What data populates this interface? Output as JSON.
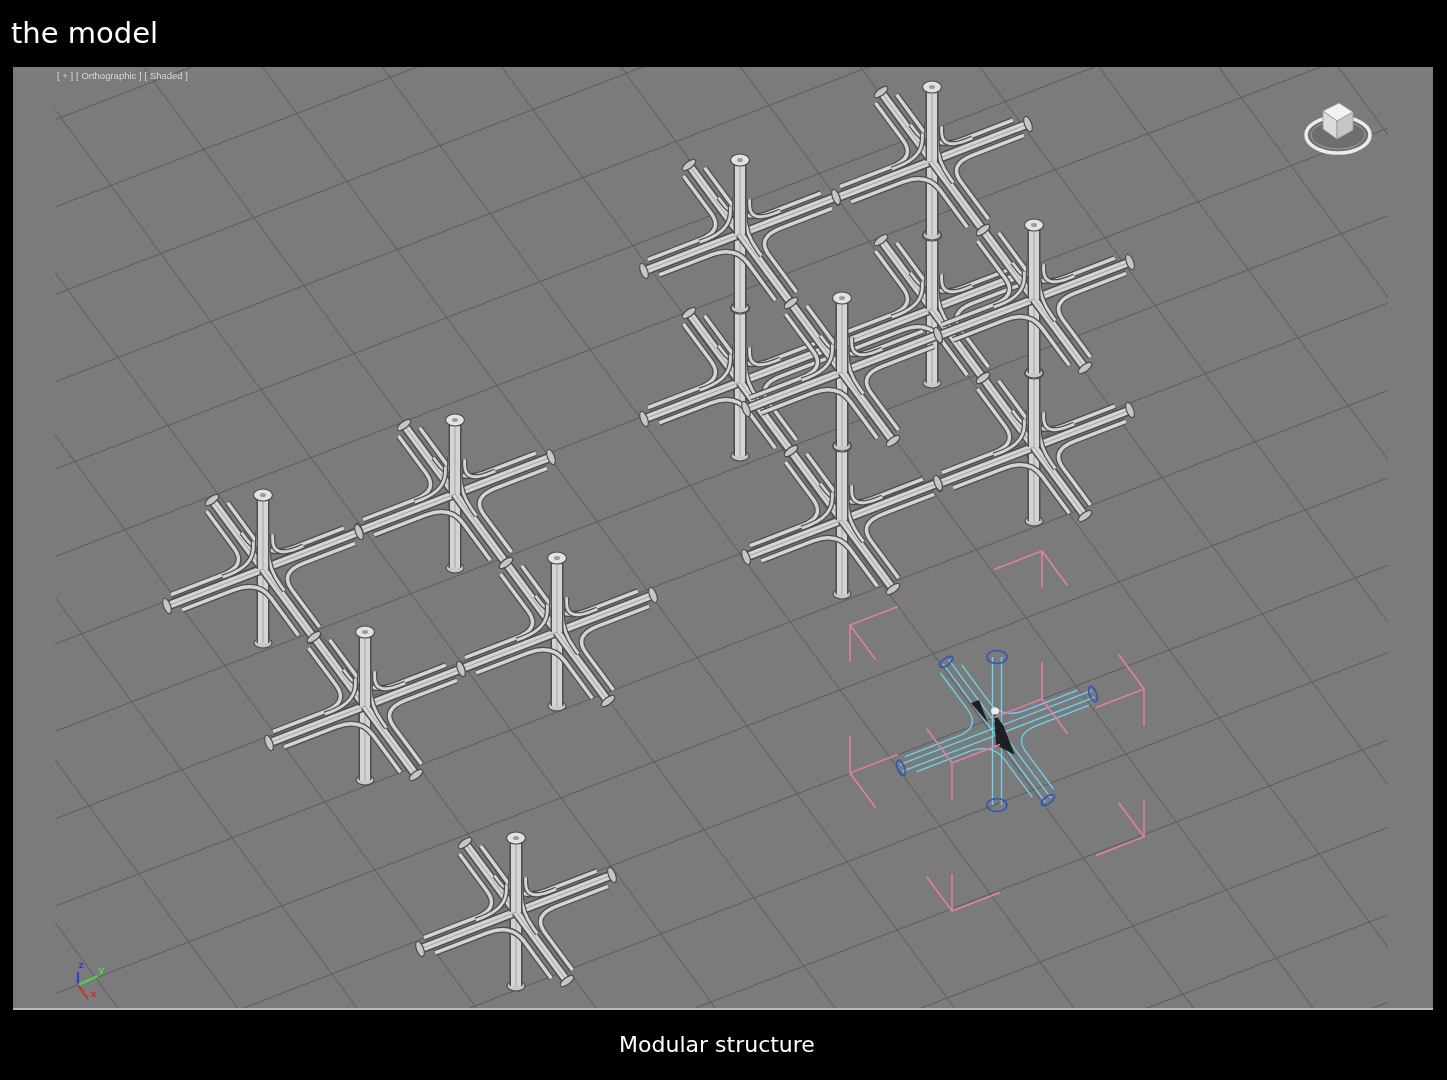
{
  "title": "the model",
  "viewport": {
    "menus": [
      "[ + ]",
      "[ Orthographic ]",
      "[ Shaded ]"
    ],
    "modules": [
      {
        "selected": false
      },
      {
        "selected": false
      },
      {
        "selected": false
      },
      {
        "selected": false
      },
      {
        "selected": false
      },
      {
        "selected": false
      },
      {
        "selected": false
      },
      {
        "selected": false
      },
      {
        "selected": false
      },
      {
        "selected": false
      },
      {
        "selected": false
      },
      {
        "selected": false
      },
      {
        "selected": true
      },
      {
        "selected": false
      }
    ],
    "axis_gizmo": {
      "axes": [
        {
          "label": "z",
          "color": "#3a3ad0"
        },
        {
          "label": "y",
          "color": "#4fd44f"
        },
        {
          "label": "x",
          "color": "#c83232"
        }
      ]
    }
  },
  "caption": "Modular structure"
}
